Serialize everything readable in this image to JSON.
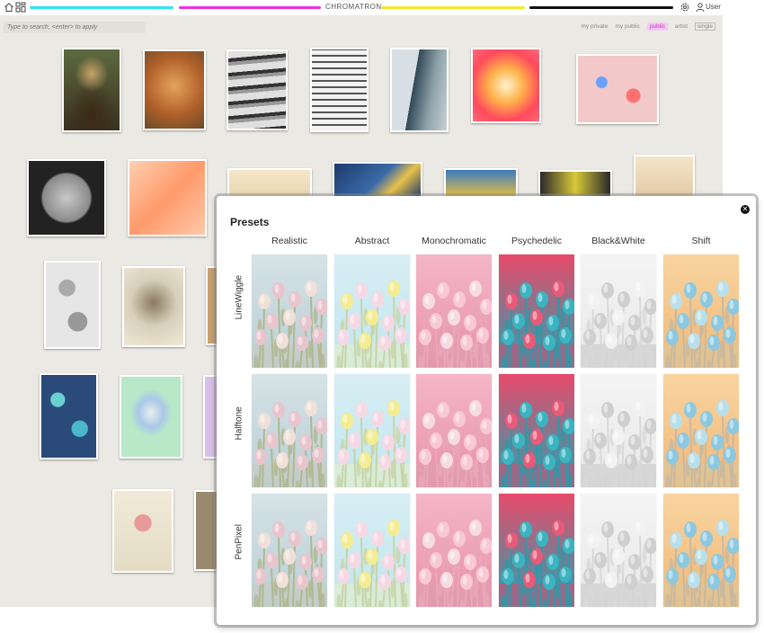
{
  "app": {
    "title": "CHROMATRON",
    "user_label": "User",
    "colors": {
      "cyan": "#2fe4f2",
      "magenta": "#f02de0",
      "yellow": "#f2ea32",
      "black": "#111111",
      "pink_active": "#f6c6f4"
    }
  },
  "toolbar": {
    "search_placeholder": "Type to search, <enter> to apply",
    "filters": [
      "my private",
      "my public",
      "public",
      "artist",
      "single"
    ],
    "active_filter": "public"
  },
  "modal": {
    "title": "Presets",
    "columns": [
      "Realistic",
      "Abstract",
      "Monochromatic",
      "Psychedelic",
      "Black&White",
      "Shift"
    ],
    "rows": [
      "LineWiggle",
      "Halftone",
      "PenPixel"
    ]
  },
  "icons": [
    "home-icon",
    "layout-grid-icon",
    "settings-icon",
    "user-icon",
    "close-icon"
  ]
}
